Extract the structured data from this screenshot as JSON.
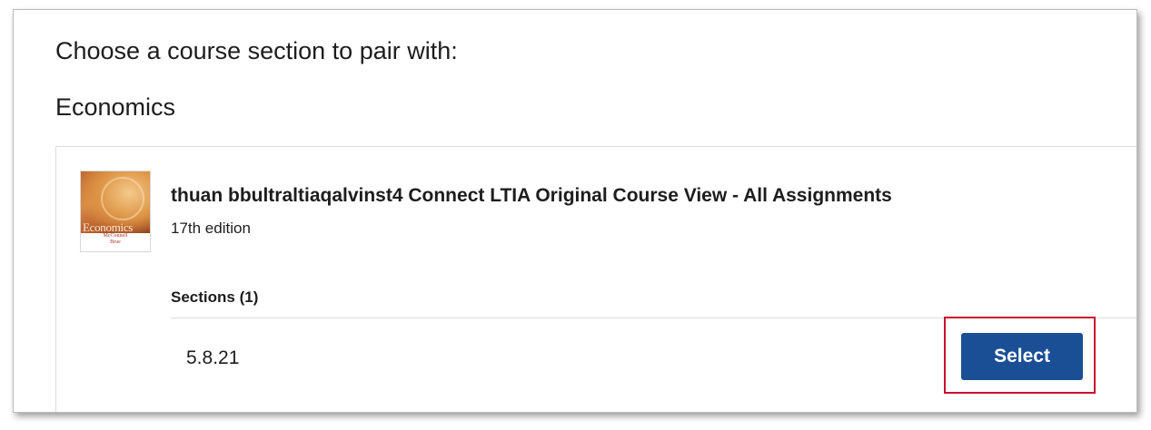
{
  "page": {
    "prompt_title": "Choose a course section to pair with:",
    "subject_title": "Economics"
  },
  "course": {
    "cover": {
      "title": "Economics",
      "authors_line1": "McConnell",
      "authors_line2": "Brue",
      "icon": "book-cover-image"
    },
    "name": "thuan bbultraltiaqalvinst4 Connect LTIA Original Course View - All Assignments",
    "edition": "17th edition",
    "sections_heading": "Sections (1)",
    "sections": [
      {
        "name": "5.8.21",
        "action_label": "Select"
      }
    ]
  },
  "colors": {
    "select_button": "#1a4f96",
    "highlight_box": "#c8102e",
    "text": "#1d1d1d"
  }
}
